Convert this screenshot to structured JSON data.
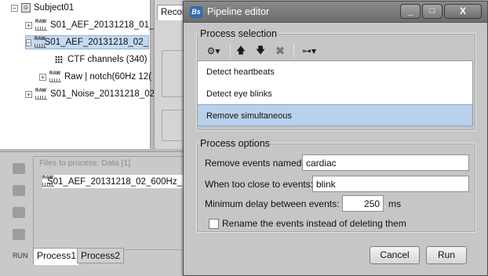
{
  "background": {
    "tree": {
      "subject": "Subject01",
      "items": [
        {
          "label": "S01_AEF_20131218_01_"
        },
        {
          "label": "S01_AEF_20131218_02_"
        },
        {
          "label": "CTF channels (340)"
        },
        {
          "label": "Raw | notch(60Hz 12("
        },
        {
          "label": "S01_Noise_20131218_02"
        }
      ]
    },
    "record_tab": "Record",
    "files_panel": {
      "legend": "Files to process: Data [1]",
      "file": "S01_AEF_20131218_02_600Hz_"
    },
    "run_label": "RUN",
    "process_tabs": [
      "Process1",
      "Process2"
    ],
    "raw_badge": "RAW"
  },
  "dialog": {
    "title": "Pipeline editor",
    "app_icon": "Bs",
    "window_buttons": {
      "minimize": "_",
      "maximize": "□",
      "close": "X"
    },
    "process_selection": {
      "title": "Process selection",
      "toolbar": [
        {
          "icon": "gear-dropdown-icon"
        },
        {
          "icon": "arrow-up-icon"
        },
        {
          "icon": "arrow-down-icon"
        },
        {
          "icon": "delete-x-icon"
        },
        {
          "icon": "tree-dropdown-icon"
        }
      ],
      "processes": [
        {
          "label": "Detect heartbeats",
          "selected": false
        },
        {
          "label": "Detect eye blinks",
          "selected": false
        },
        {
          "label": "Remove simultaneous",
          "selected": true
        }
      ]
    },
    "process_options": {
      "title": "Process options",
      "remove_events_label": "Remove events named:",
      "remove_events_value": "cardiac",
      "too_close_label": "When too close to events:",
      "too_close_value": "blink",
      "min_delay_label": "Minimum delay between events:",
      "min_delay_value": "250",
      "min_delay_unit": "ms",
      "rename_label": "Rename the events instead of deleting them",
      "rename_checked": false
    },
    "buttons": {
      "cancel": "Cancel",
      "run": "Run"
    }
  }
}
